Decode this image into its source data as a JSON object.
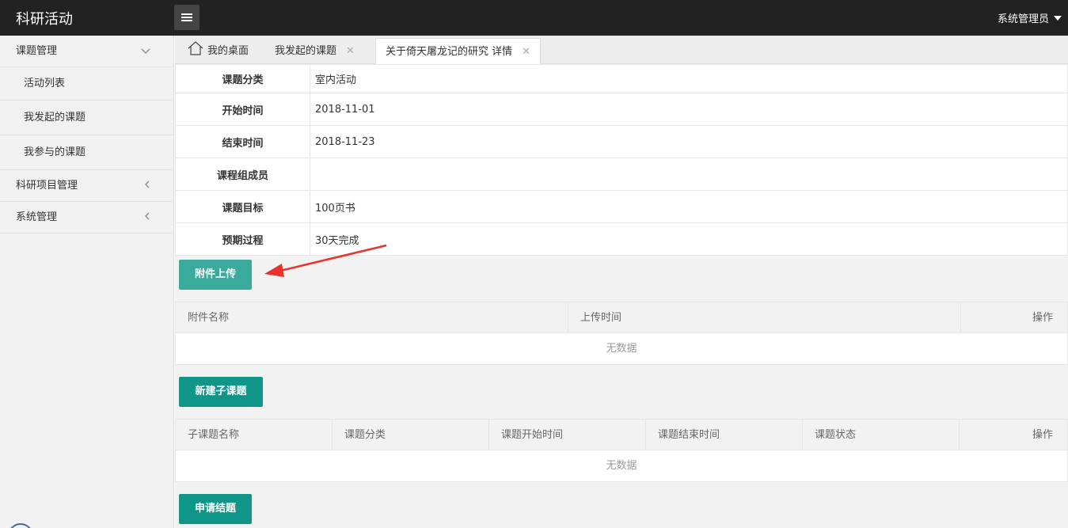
{
  "header": {
    "app_title": "科研活动",
    "user_label": "系统管理员"
  },
  "sidebar": {
    "groups": [
      {
        "label": "课题管理",
        "items": [
          "活动列表",
          "我发起的课题",
          "我参与的课题"
        ]
      },
      {
        "label": "科研项目管理"
      },
      {
        "label": "系统管理"
      }
    ]
  },
  "tabs": [
    {
      "label": "我的桌面",
      "icon": "home-icon"
    },
    {
      "label": "我发起的课题"
    },
    {
      "label": "关于倚天屠龙记的研究 详情",
      "active": true
    }
  ],
  "detail": [
    {
      "label": "课题分类",
      "value": "室内活动"
    },
    {
      "label": "开始时间",
      "value": "2018-11-01"
    },
    {
      "label": "结束时间",
      "value": "2018-11-23"
    },
    {
      "label": "课程组成员",
      "value": ""
    },
    {
      "label": "课题目标",
      "value": "100页书"
    },
    {
      "label": "预期过程",
      "value": "30天完成"
    }
  ],
  "buttons": {
    "upload": "附件上传",
    "new_subtopic": "新建子课题",
    "apply_close": "申请结题"
  },
  "attachments_table": {
    "columns": [
      "附件名称",
      "上传时间",
      "操作"
    ],
    "empty_text": "无数据"
  },
  "subtopics_table": {
    "columns": [
      "子课题名称",
      "课题分类",
      "课题开始时间",
      "课题结束时间",
      "课题状态",
      "操作"
    ],
    "empty_text": "无数据"
  },
  "colors": {
    "topbar": "#222222",
    "primary": "#0f9688",
    "upload_button": "#3aaa9c",
    "annotation_arrow": "#e8322b"
  }
}
